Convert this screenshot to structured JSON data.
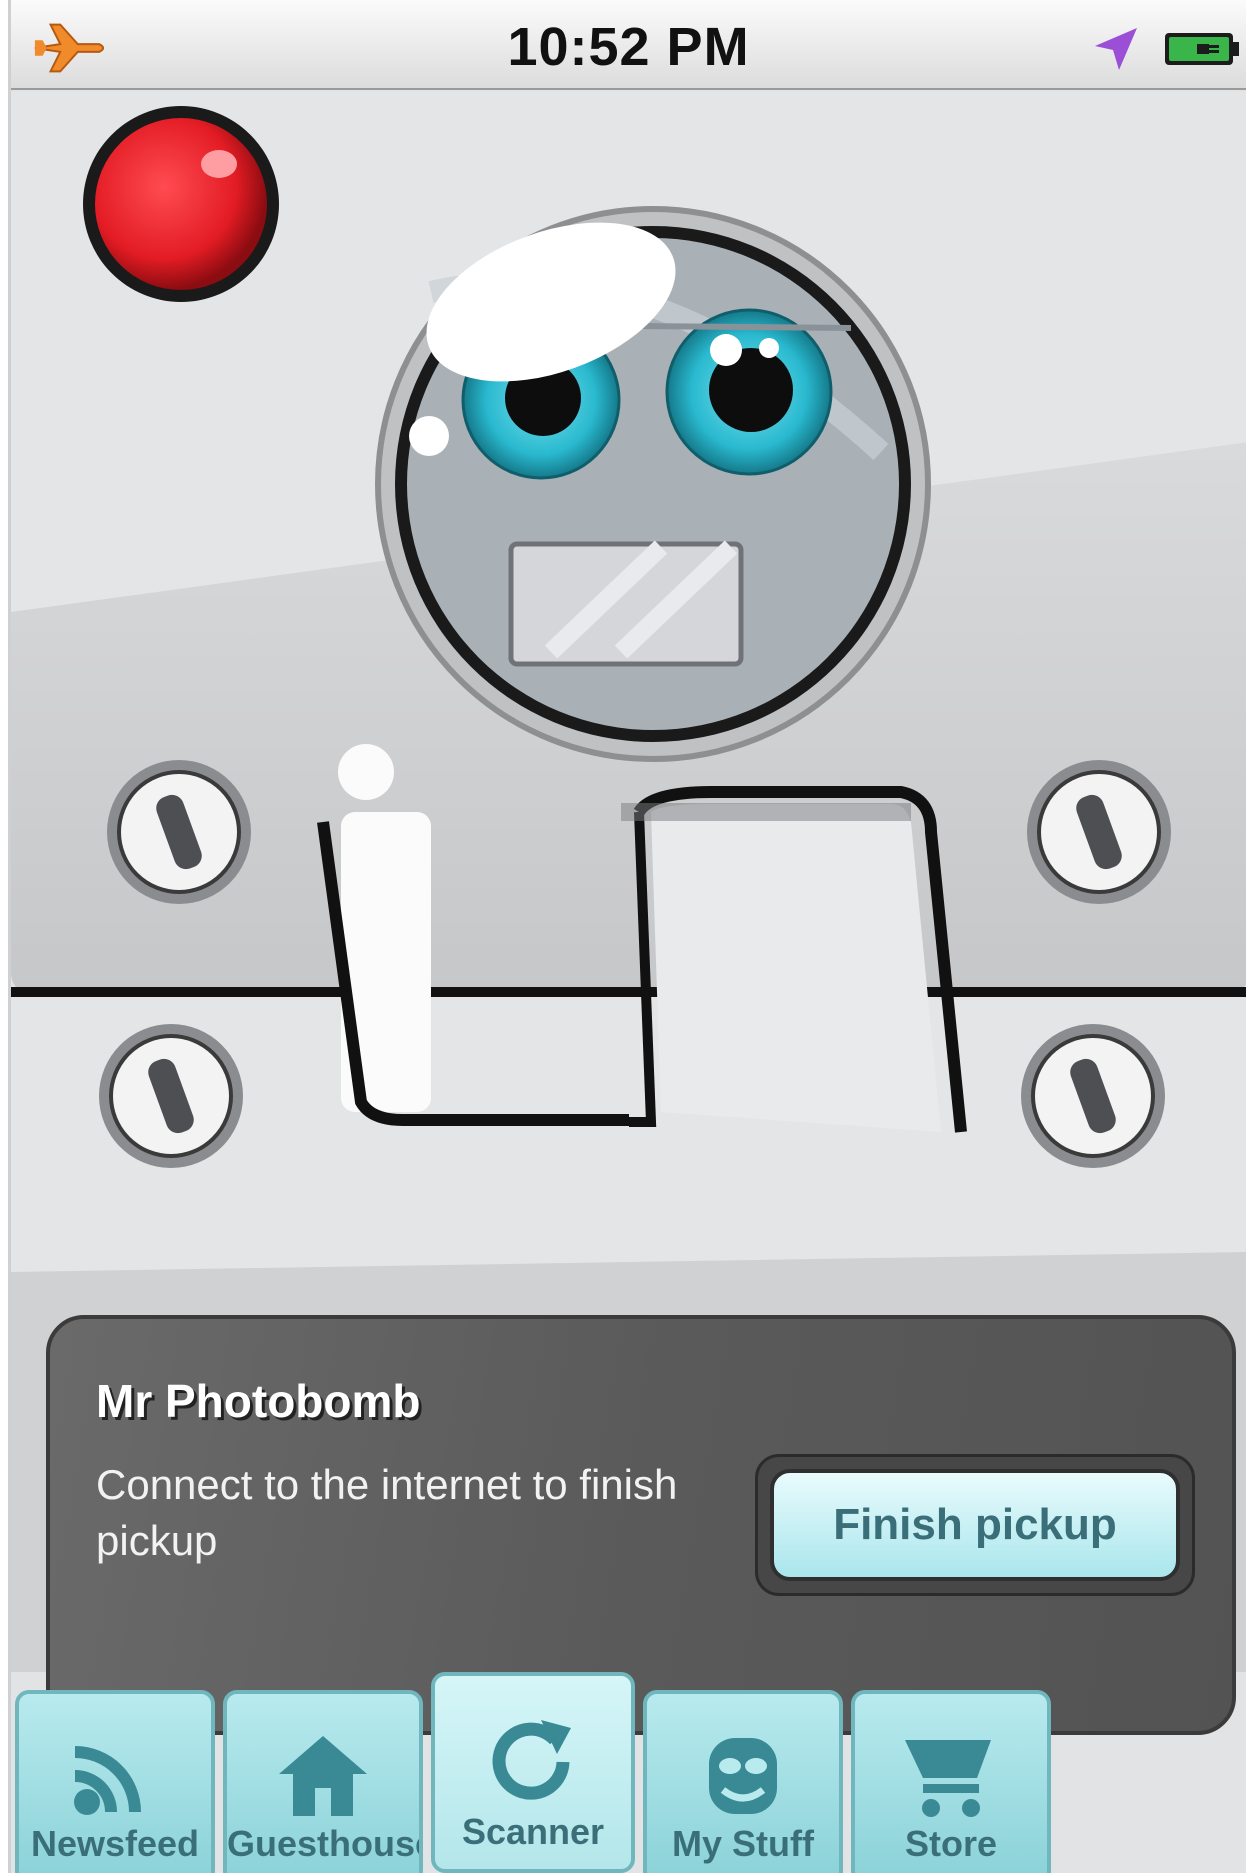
{
  "status_bar": {
    "time": "10:52 PM",
    "icons": [
      "airplane-icon",
      "location-icon",
      "battery-charging-icon"
    ]
  },
  "scene": {
    "icons": [
      "record-button-icon",
      "robot-face-icon",
      "screw-icon"
    ]
  },
  "card": {
    "title": "Mr Photobomb",
    "message": "Connect to the internet to finish pickup",
    "button_label": "Finish pickup"
  },
  "tabs": [
    {
      "label": "Newsfeed",
      "icon": "rss-icon"
    },
    {
      "label": "Guesthouse",
      "icon": "house-icon"
    },
    {
      "label": "Scanner",
      "icon": "refresh-icon"
    },
    {
      "label": "My Stuff",
      "icon": "mask-icon"
    },
    {
      "label": "Store",
      "icon": "cart-icon"
    }
  ],
  "colors": {
    "accent": "#9fdfe5",
    "accent_text": "#3a6f7a",
    "record": "#e31c24",
    "eye": "#29b9cf",
    "card_bg": "#5e5e5e"
  }
}
